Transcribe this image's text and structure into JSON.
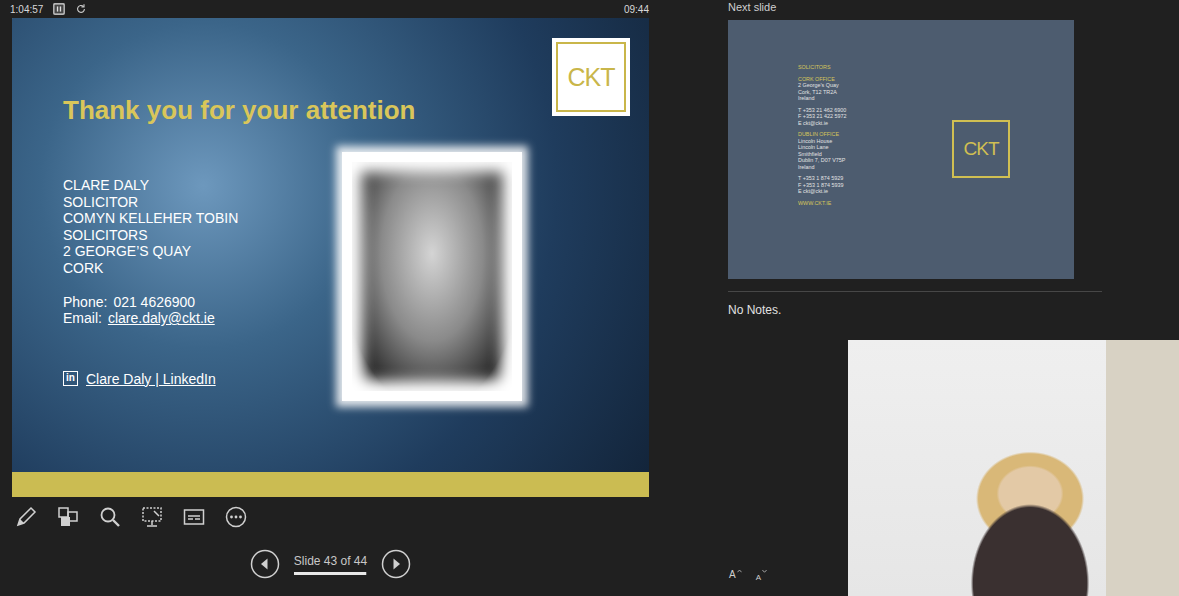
{
  "presenter": {
    "elapsed": "1:04:57",
    "clock": "09:44"
  },
  "slide": {
    "title": "Thank you for your attention",
    "logo": "CKT",
    "contact": [
      "CLARE DALY",
      "SOLICITOR",
      "COMYN KELLEHER TOBIN",
      "SOLICITORS",
      "2 GEORGE’S QUAY",
      "CORK"
    ],
    "phone": {
      "label": "Phone:",
      "value": "021 4626900"
    },
    "email": {
      "label": "Email:",
      "value": "clare.daly@ckt.ie"
    },
    "linkedin": {
      "icon": "in",
      "label": "Clare Daly | LinkedIn"
    }
  },
  "navigation": {
    "label": "Slide 43 of 44",
    "level": 0.98
  },
  "next_slide": {
    "label": "Next slide",
    "logo": "CKT",
    "blocks": [
      {
        "kind": "heading",
        "lines": [
          "SOLICITORS"
        ]
      },
      {
        "kind": "office",
        "lines": [
          "CORK OFFICE",
          "2 George’s Quay",
          "Cork, T12 TR2A",
          "Ireland"
        ]
      },
      {
        "kind": "contact",
        "lines": [
          "T +353 21 462 6900",
          "F +353 21 422 5972",
          "E ckt@ckt.ie"
        ]
      },
      {
        "kind": "office",
        "lines": [
          "DUBLIN OFFICE",
          "Lincoln House",
          "Lincoln Lane",
          "Smithfield",
          "Dublin 7, D07 V75P",
          "Ireland"
        ]
      },
      {
        "kind": "contact",
        "lines": [
          "T +353 1 874 5929",
          "F +353 1 874 5939",
          "E ckt@ckt.ie"
        ]
      },
      {
        "kind": "web",
        "lines": [
          "WWW.CKT.IE"
        ]
      }
    ]
  },
  "notes": {
    "text": "No Notes."
  },
  "font_buttons": [
    {
      "label": "A",
      "kind": "grow"
    },
    {
      "label": "A",
      "kind": "shrink"
    }
  ]
}
